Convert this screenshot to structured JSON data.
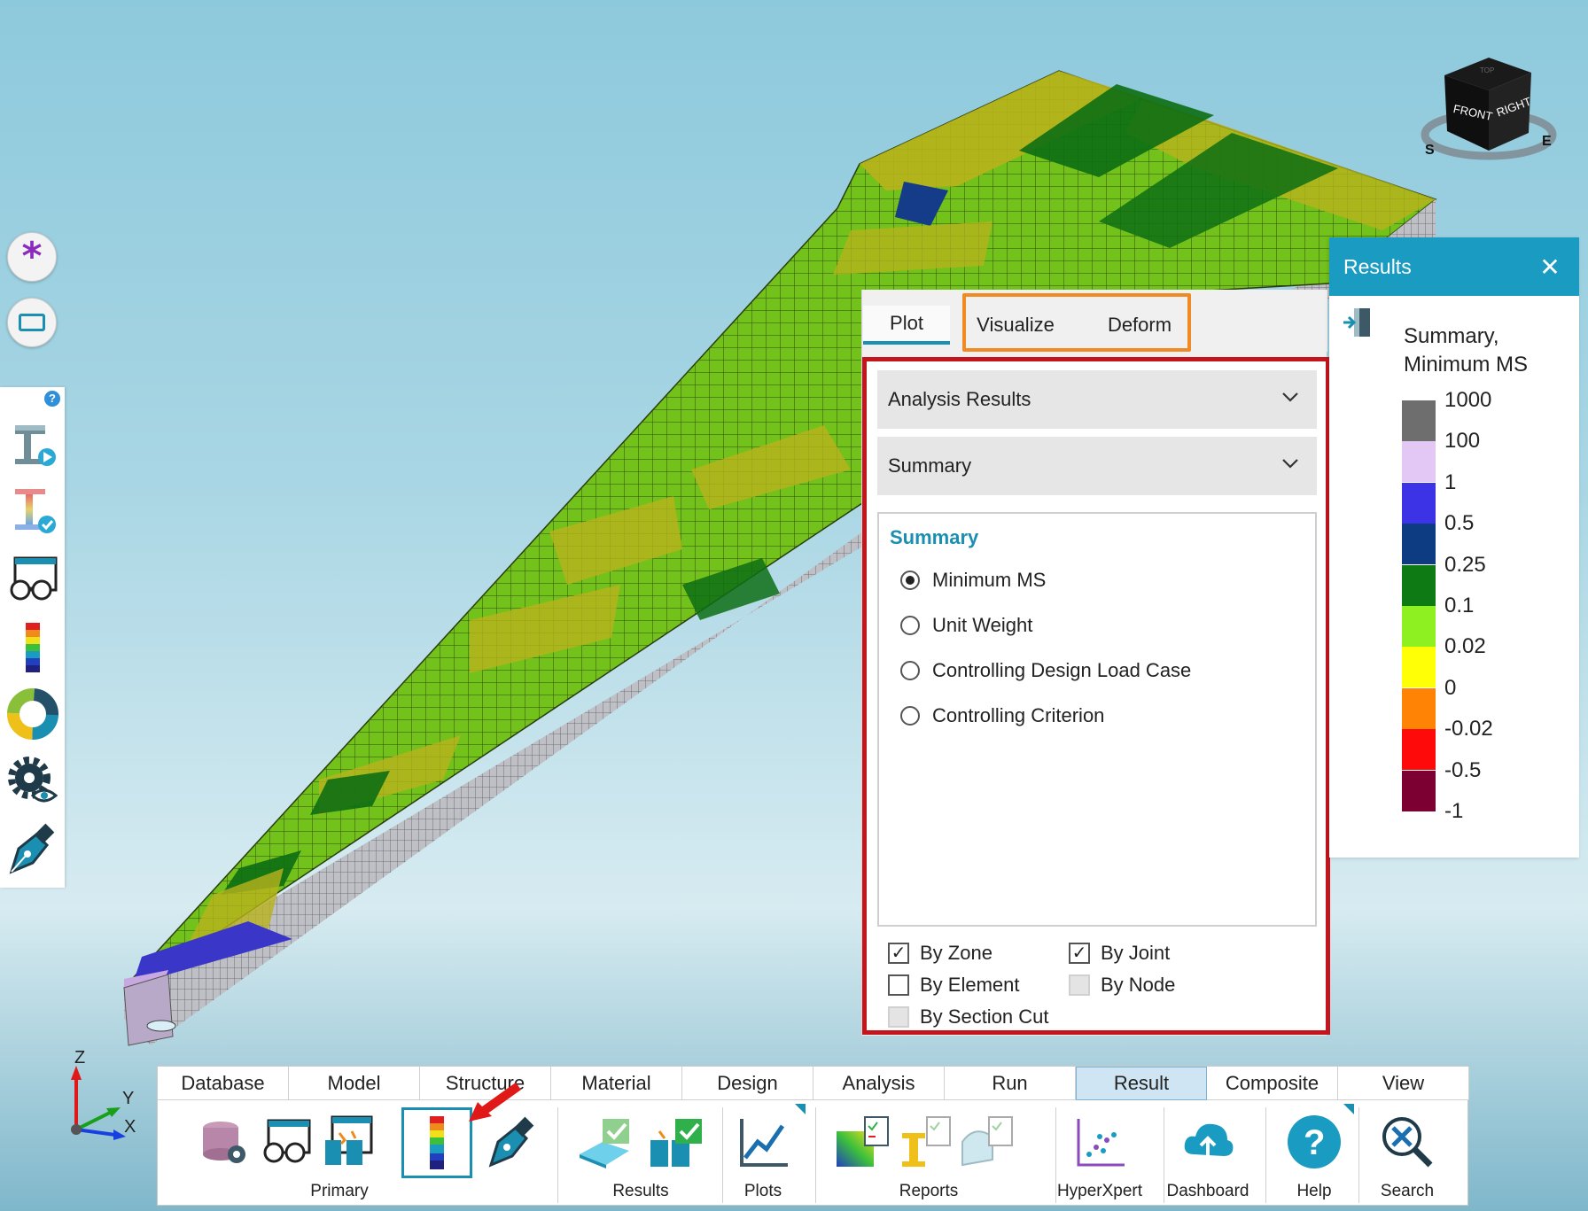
{
  "viewcube": {
    "faces": [
      "FRONT",
      "RIGHT",
      "TOP"
    ],
    "compass": [
      "S",
      "E"
    ]
  },
  "left_buttons": [
    {
      "icon": "asterisk-icon"
    },
    {
      "icon": "rectangle-icon"
    }
  ],
  "left_toolbar": {
    "help": "?",
    "icons": [
      "beam-play-icon",
      "beam-check-icon",
      "glasses-window-icon",
      "color-legend-icon",
      "color-wheel-icon",
      "gear-eye-icon",
      "pen-icon"
    ]
  },
  "plot_panel": {
    "tabs": [
      {
        "label": "Plot",
        "active": true
      },
      {
        "label": "Visualize",
        "active": false
      },
      {
        "label": "Deform",
        "active": false
      }
    ],
    "dropdown_1": "Analysis Results",
    "dropdown_2": "Summary",
    "summary_title": "Summary",
    "radio_options": [
      {
        "label": "Minimum MS",
        "checked": true
      },
      {
        "label": "Unit Weight",
        "checked": false
      },
      {
        "label": "Controlling Design Load Case",
        "checked": false
      },
      {
        "label": "Controlling Criterion",
        "checked": false
      }
    ],
    "checkboxes": {
      "by_zone": {
        "label": "By Zone",
        "checked": true
      },
      "by_joint": {
        "label": "By Joint",
        "checked": true
      },
      "by_element": {
        "label": "By Element",
        "checked": false
      },
      "by_node": {
        "label": "By Node",
        "checked": false,
        "disabled": true
      },
      "by_section_cut": {
        "label": "By Section Cut",
        "checked": false,
        "disabled": true
      }
    }
  },
  "legend": {
    "header": "Results",
    "close": "✕",
    "title_line1": "Summary,",
    "title_line2": "Minimum MS",
    "values": [
      "1000",
      "100",
      "1",
      "0.5",
      "0.25",
      "0.1",
      "0.02",
      "0",
      "-0.02",
      "-0.5",
      "-1"
    ],
    "colors": [
      "#6e6e6e",
      "#e3c8f5",
      "#3c32e6",
      "#0d3c82",
      "#0d7a14",
      "#8ff021",
      "#ffff05",
      "#ff8405",
      "#ff0a0a",
      "#7d0032"
    ]
  },
  "triad": {
    "z": "Z",
    "y": "Y",
    "x": "X"
  },
  "ribbon": {
    "tabs": [
      "Database",
      "Model",
      "Structure",
      "Material",
      "Design",
      "Analysis",
      "Run",
      "Result",
      "Composite",
      "View"
    ],
    "active_tab": "Result",
    "groups": {
      "primary": "Primary",
      "results": "Results",
      "plots": "Plots",
      "reports": "Reports",
      "hyperxpert": "HyperXpert",
      "dashboard": "Dashboard",
      "help": "Help",
      "search": "Search"
    }
  }
}
